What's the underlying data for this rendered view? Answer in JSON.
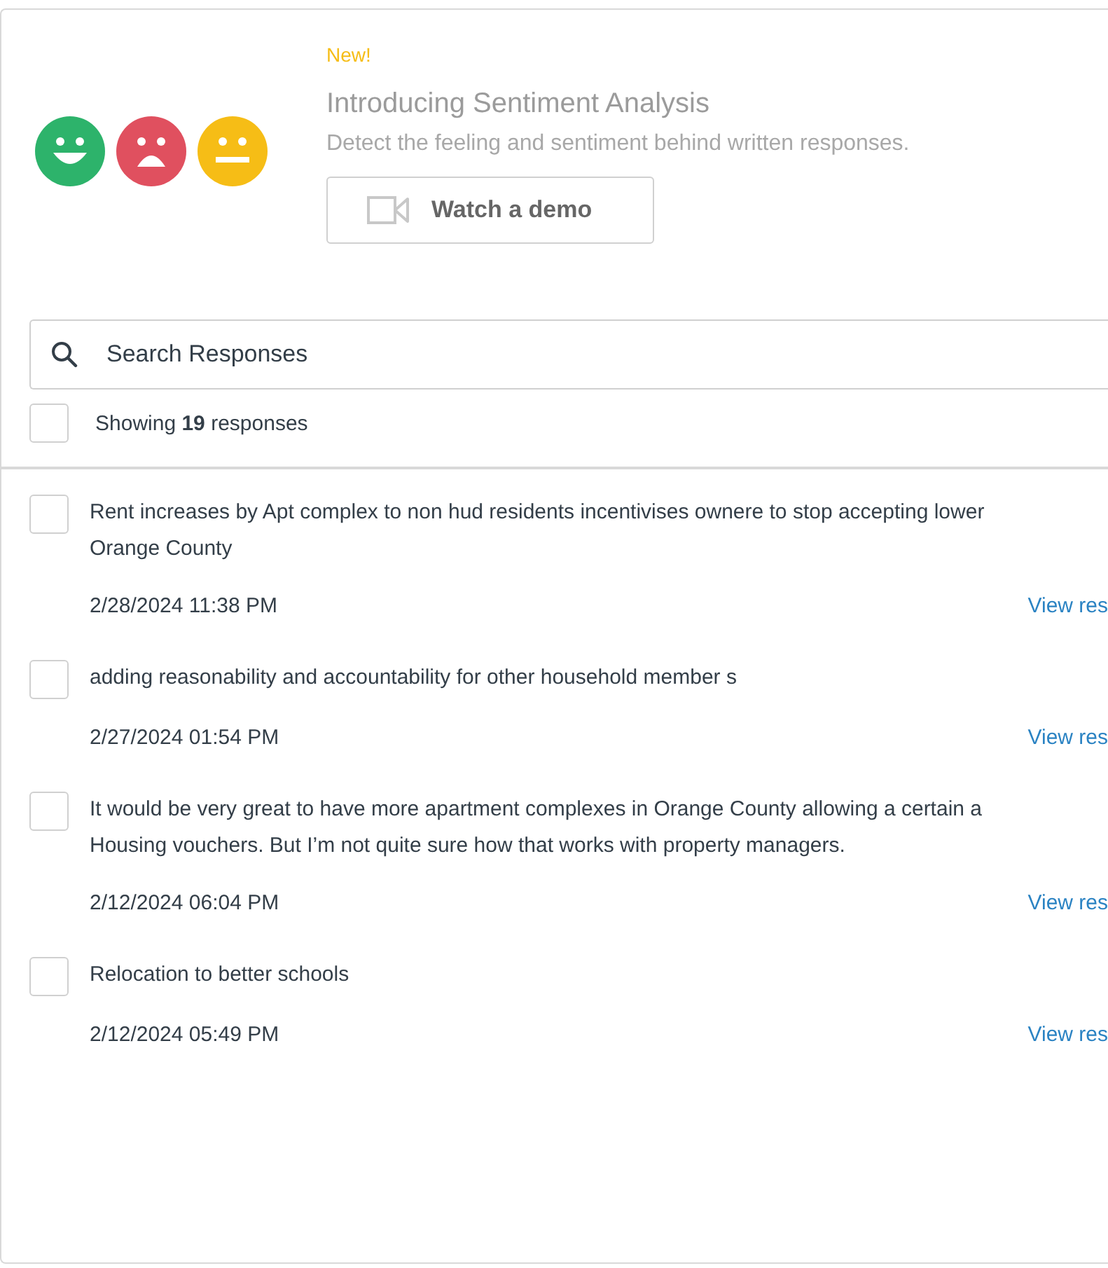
{
  "promo": {
    "badge": "New!",
    "title": "Introducing Sentiment Analysis",
    "description": "Detect the feeling and sentiment behind written responses.",
    "button": "Watch a demo"
  },
  "search": {
    "placeholder": "Search Responses"
  },
  "summary": {
    "checked": false,
    "text": "Showing **19** responses"
  },
  "responses": [
    {
      "checked": false,
      "lines": [
        "Rent increases by Apt complex to non hud residents incentivises ownere to stop accepting lower",
        "Orange County"
      ],
      "date": "2/28/2024 11:38 PM",
      "link": "View res"
    },
    {
      "checked": false,
      "lines": [
        "adding reasonability and accountability for other household member s"
      ],
      "date": "2/27/2024 01:54 PM",
      "link": "View res"
    },
    {
      "checked": false,
      "lines": [
        "It would be very great to have more apartment complexes in Orange County allowing a certain a",
        "Housing vouchers. But I’m not quite sure how that works with property managers."
      ],
      "date": "2/12/2024 06:04 PM",
      "link": "View res"
    },
    {
      "checked": false,
      "lines": [
        "Relocation to better schools"
      ],
      "date": "2/12/2024 05:49 PM",
      "link": "View res"
    }
  ]
}
